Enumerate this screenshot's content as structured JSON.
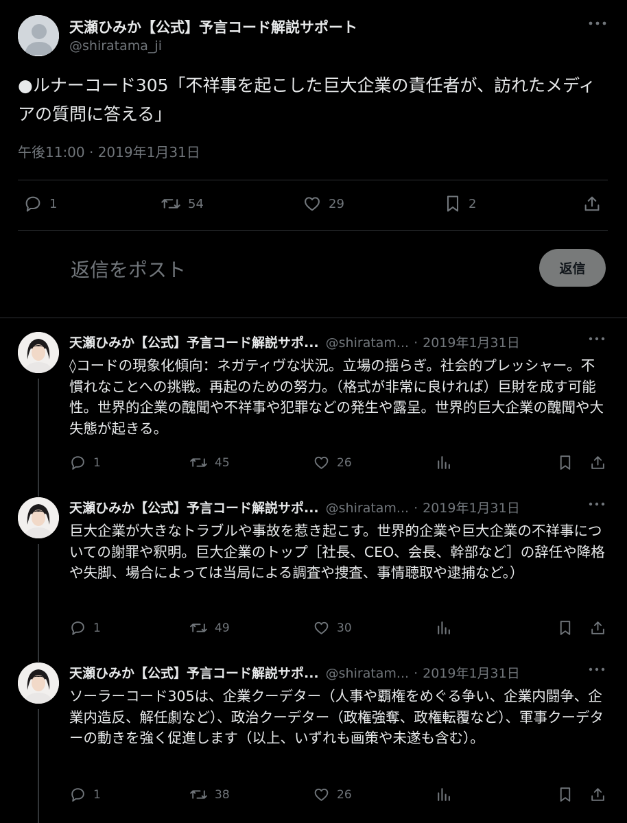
{
  "main_tweet": {
    "display_name": "天瀬ひみか【公式】予言コード解説サポート",
    "handle": "@shiratama_ji",
    "text": "●ルナーコード305「不祥事を起こした巨大企業の責任者が、訪れたメディアの質問に答える」",
    "timestamp": "午後11:00 · 2019年1月31日",
    "stats": {
      "replies": "1",
      "reposts": "54",
      "likes": "29",
      "bookmarks": "2"
    }
  },
  "reply_composer": {
    "placeholder": "返信をポスト",
    "button_label": "返信"
  },
  "replies": [
    {
      "display_name": "天瀬ひみか【公式】予言コード解説サポ...",
      "handle": "@shiratam...",
      "date": "2019年1月31日",
      "text": "◊コードの現象化傾向：ネガティヴな状況。立場の揺らぎ。社会的プレッシャー。不慣れなことへの挑戦。再起のための努力。（格式が非常に良ければ）巨財を成す可能性。世界的企業の醜聞や不祥事や犯罪などの発生や露呈。世界的巨大企業の醜聞や大失態が起きる。",
      "replies": "1",
      "reposts": "45",
      "likes": "26"
    },
    {
      "display_name": "天瀬ひみか【公式】予言コード解説サポ...",
      "handle": "@shiratam...",
      "date": "2019年1月31日",
      "text": "巨大企業が大きなトラブルや事故を惹き起こす。世界的企業や巨大企業の不祥事についての謝罪や釈明。巨大企業のトップ［社長、CEO、会長、幹部など］の辞任や降格や失脚、場合によっては当局による調査や捜査、事情聴取や逮捕など。）",
      "replies": "1",
      "reposts": "49",
      "likes": "30"
    },
    {
      "display_name": "天瀬ひみか【公式】予言コード解説サポ...",
      "handle": "@shiratam...",
      "date": "2019年1月31日",
      "text": "ソーラーコード305は、企業クーデター（人事や覇権をめぐる争い、企業内闘争、企業内造反、解任劇など）、政治クーデター（政権強奪、政権転覆など）、軍事クーデターの動きを強く促進します（以上、いずれも画策や未遂も含む）。",
      "replies": "1",
      "reposts": "38",
      "likes": "26"
    }
  ],
  "colors": {
    "background": "#000000",
    "text": "#e7e9ea",
    "secondary": "#71767b",
    "divider": "#2f3336",
    "reply_button": "#787a7a"
  }
}
